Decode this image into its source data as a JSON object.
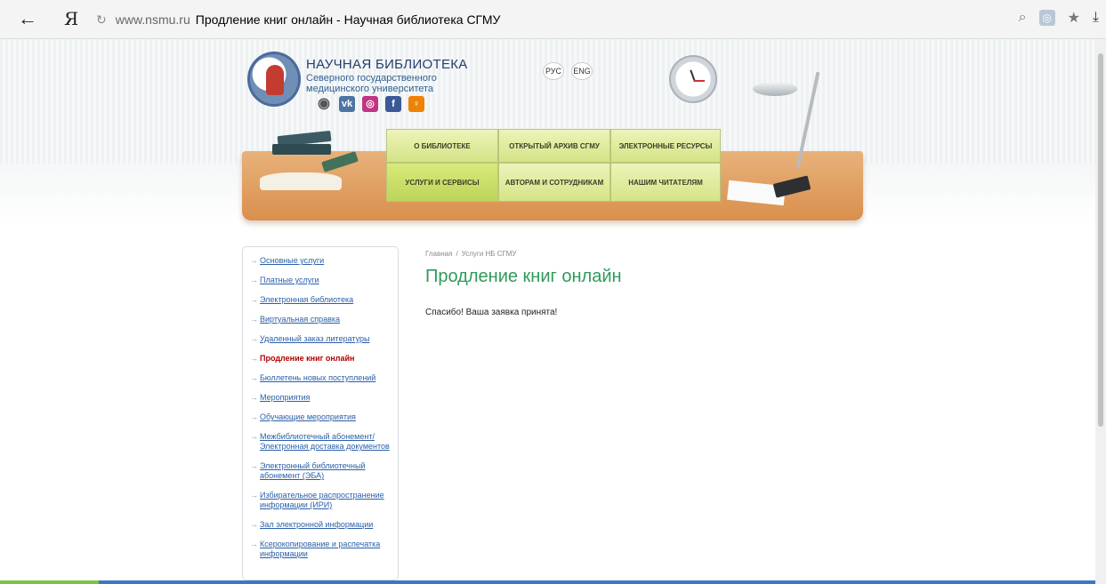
{
  "browser": {
    "back_icon": "←",
    "yandex_logo": "Я",
    "reload_icon": "reload-icon",
    "url": "www.nsmu.ru",
    "title": "Продление книг онлайн - Научная библиотека СГМУ"
  },
  "header": {
    "title": "НАУЧНАЯ БИБЛИОТЕКА",
    "subtitle_line1": "Северного государственного",
    "subtitle_line2": "медицинского университета",
    "lang_ru": "РУС",
    "lang_en": "ENG"
  },
  "menu": {
    "items": [
      {
        "label": "О БИБЛИОТЕКЕ"
      },
      {
        "label": "ОТКРЫТЫЙ АРХИВ СГМУ"
      },
      {
        "label": "ЭЛЕКТРОННЫЕ РЕСУРСЫ"
      },
      {
        "label": "УСЛУГИ И СЕРВИСЫ"
      },
      {
        "label": "АВТОРАМ И СОТРУДНИКАМ"
      },
      {
        "label": "НАШИМ ЧИТАТЕЛЯМ"
      }
    ]
  },
  "sidebar": {
    "items": [
      {
        "label": "Основные услуги"
      },
      {
        "label": "Платные услуги"
      },
      {
        "label": "Электронная библиотека"
      },
      {
        "label": "Виртуальная справка"
      },
      {
        "label": "Удаленный заказ литературы"
      },
      {
        "label": "Продление книг онлайн"
      },
      {
        "label": "Бюллетень новых поступлений"
      },
      {
        "label": "Мероприятия"
      },
      {
        "label": "Обучающие мероприятия"
      },
      {
        "label": "Межбиблиотечный абонемент/ Электронная доставка документов"
      },
      {
        "label": "Электронный библиотечный абонемент (ЭБА)"
      },
      {
        "label": "Избирательное распространение информации (ИРИ)"
      },
      {
        "label": "Зал электронной информации"
      },
      {
        "label": "Ксерокопирование и распечатка информации"
      }
    ]
  },
  "breadcrumb": {
    "home": "Главная",
    "separator": "/",
    "section": "Услуги НБ СГМУ"
  },
  "main": {
    "title": "Продление книг онлайн",
    "message": "Спасибо! Ваша заявка принята!"
  },
  "colors": {
    "title_green": "#2f9a5a",
    "link_blue": "#2b5fa8",
    "active_red": "#b00000",
    "menu_green": "#d4e486"
  }
}
